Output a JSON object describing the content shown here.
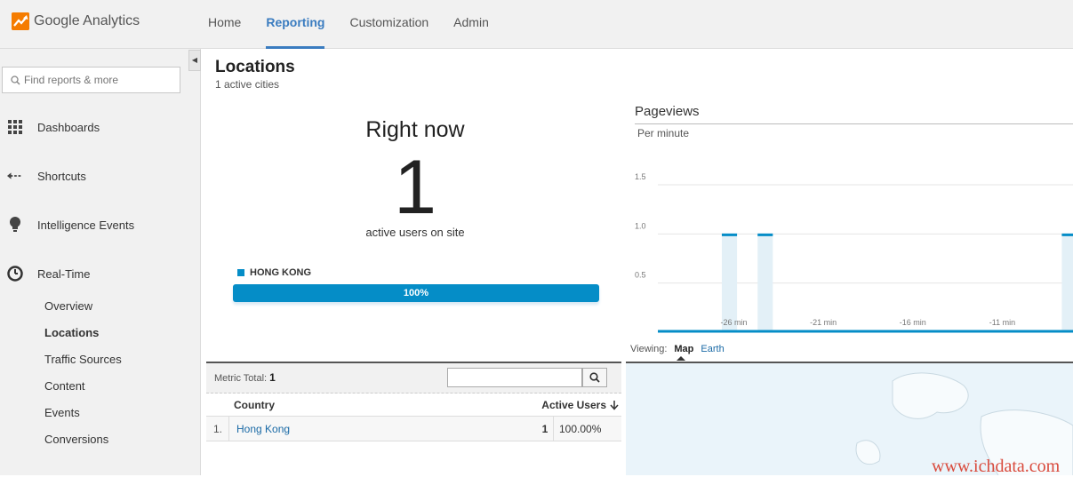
{
  "app": {
    "name": "Google Analytics"
  },
  "nav": {
    "tabs": [
      "Home",
      "Reporting",
      "Customization",
      "Admin"
    ],
    "active": "Reporting"
  },
  "sidebar": {
    "search_placeholder": "Find reports & more",
    "sections": [
      {
        "label": "Dashboards",
        "icon": "grid-icon"
      },
      {
        "label": "Shortcuts",
        "icon": "shortcut-arrow-icon"
      },
      {
        "label": "Intelligence Events",
        "icon": "lightbulb-icon"
      },
      {
        "label": "Real-Time",
        "icon": "clock-icon"
      }
    ],
    "realtime_items": [
      "Overview",
      "Locations",
      "Traffic Sources",
      "Content",
      "Events",
      "Conversions"
    ],
    "active_item": "Locations"
  },
  "page": {
    "title": "Locations",
    "subtitle": "1 active cities"
  },
  "rightnow": {
    "heading": "Right now",
    "count": "1",
    "label": "active users on site",
    "legend": "HONG KONG",
    "bar_text": "100%",
    "bar_fraction": 1.0
  },
  "table": {
    "metric_label": "Metric Total:",
    "metric_value": "1",
    "columns": [
      "Country",
      "Active Users"
    ],
    "rows": [
      {
        "index": "1.",
        "country": "Hong Kong",
        "users": "1",
        "percent": "100.00%"
      }
    ]
  },
  "chart": {
    "title": "Pageviews",
    "subtitle": "Per minute",
    "viewing_label": "Viewing:",
    "views": [
      "Map",
      "Earth"
    ],
    "active_view": "Map",
    "watermark": "www.ichdata.com"
  },
  "chart_data": {
    "type": "bar",
    "title": "Pageviews",
    "subtitle": "Per minute",
    "y_ticks": [
      "1.5",
      "1.0",
      "0.5"
    ],
    "x_tick_labels": [
      "-26 min",
      "-21 min",
      "-16 min",
      "-11 min"
    ],
    "ylim": [
      0,
      1.5
    ],
    "x": [
      -30,
      -29,
      -28,
      -27,
      -26,
      -25,
      -24,
      -23,
      -22,
      -21,
      -20,
      -19,
      -18,
      -17,
      -16,
      -15,
      -14,
      -13,
      -12,
      -11,
      -10,
      -9,
      -8,
      -7
    ],
    "values": [
      0,
      0,
      0,
      0,
      1,
      0,
      1,
      0,
      0,
      0,
      0,
      0,
      0,
      0,
      0,
      0,
      0,
      0,
      0,
      0,
      0,
      0,
      0,
      1
    ],
    "grid": true,
    "colors": {
      "bar_fill": "#e3f0f7",
      "bar_top": "#058dc7",
      "baseline": "#058dc7"
    }
  },
  "colors": {
    "accent": "#058dc7",
    "nav_active": "#3a7cc0",
    "logo": "#f57c00"
  }
}
